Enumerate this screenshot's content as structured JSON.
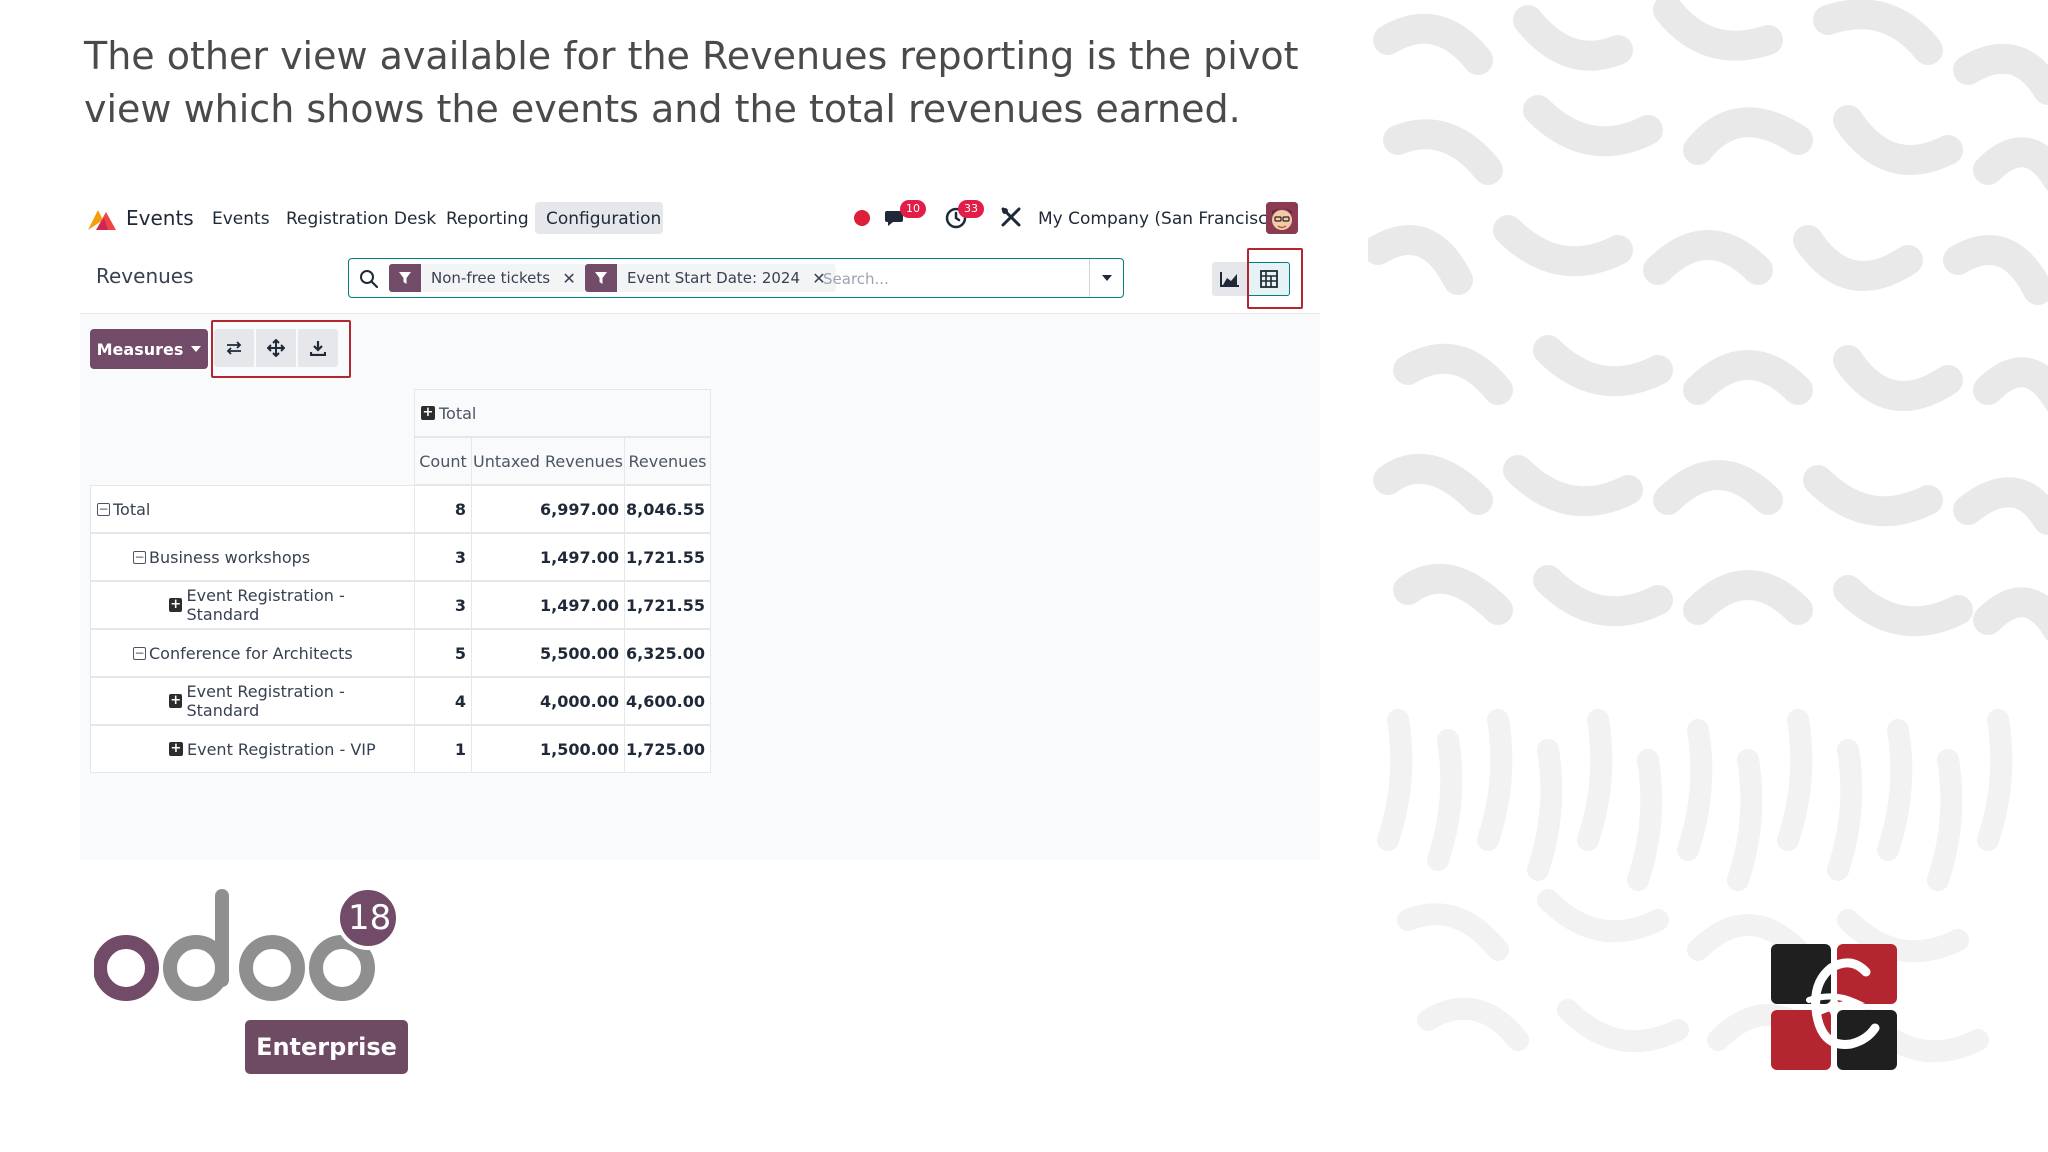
{
  "slide": {
    "heading": "The other view available for the Revenues reporting is the pivot view which shows the events and the total revenues earned."
  },
  "topbar": {
    "app_name": "Events",
    "menu": [
      "Events",
      "Registration Desk",
      "Reporting",
      "Configuration"
    ],
    "active_menu": "Configuration",
    "messages_badge": "10",
    "activities_badge": "33",
    "company": "My Company (San Francisco)"
  },
  "control": {
    "breadcrumb": "Revenues",
    "facets": [
      "Non-free tickets",
      "Event Start Date: 2024"
    ],
    "search_placeholder": "Search...",
    "measures_label": "Measures",
    "views": [
      "graph-view",
      "pivot-view"
    ],
    "active_view": "pivot-view"
  },
  "pivot": {
    "col_group": "Total",
    "measures": [
      "Count",
      "Untaxed Revenues",
      "Revenues"
    ],
    "rows": [
      {
        "label": "Total",
        "level": 0,
        "expanded": true,
        "count": "8",
        "untaxed": "6,997.00",
        "revenues": "8,046.55"
      },
      {
        "label": "Business workshops",
        "level": 1,
        "expanded": true,
        "count": "3",
        "untaxed": "1,497.00",
        "revenues": "1,721.55"
      },
      {
        "label": "Event Registration - Standard",
        "level": 2,
        "expanded": false,
        "count": "3",
        "untaxed": "1,497.00",
        "revenues": "1,721.55"
      },
      {
        "label": "Conference for Architects",
        "level": 1,
        "expanded": true,
        "count": "5",
        "untaxed": "5,500.00",
        "revenues": "6,325.00"
      },
      {
        "label": "Event Registration - Standard",
        "level": 2,
        "expanded": false,
        "count": "4",
        "untaxed": "4,000.00",
        "revenues": "4,600.00"
      },
      {
        "label": "Event Registration - VIP",
        "level": 2,
        "expanded": false,
        "count": "1",
        "untaxed": "1,500.00",
        "revenues": "1,725.00"
      }
    ]
  },
  "branding": {
    "version": "18",
    "edition": "Enterprise",
    "colors": {
      "odoo_purple": "#714b67",
      "odoo_grey": "#8f8f8f",
      "highlight": "#b3262f",
      "teal": "#017e84"
    }
  }
}
